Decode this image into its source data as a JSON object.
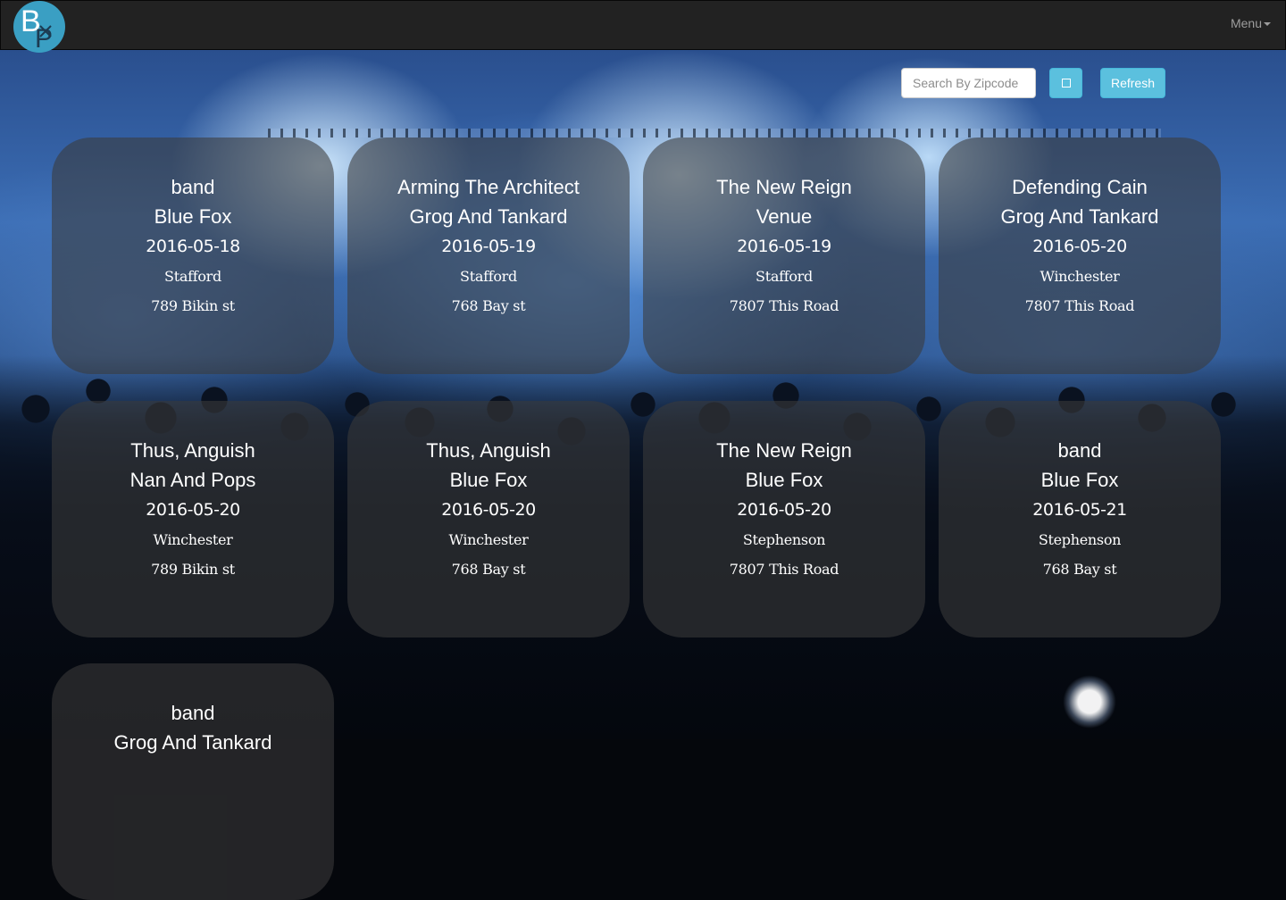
{
  "navbar": {
    "logo_letters": "BP",
    "menu_label": "Menu"
  },
  "toolbar": {
    "search_placeholder": "Search By Zipcode",
    "square_icon": "square-icon",
    "refresh_label": "Refresh"
  },
  "colors": {
    "navbar": "#222222",
    "accent": "#5bc0de",
    "logo": "#3a9fc3",
    "card": "rgba(58,58,58,0.58)"
  },
  "events": [
    {
      "band": "band",
      "venue": "Blue Fox",
      "date": "2016-05-18",
      "city": "Stafford",
      "address": "789 Bikin st"
    },
    {
      "band": "Arming The Architect",
      "venue": "Grog And Tankard",
      "date": "2016-05-19",
      "city": "Stafford",
      "address": "768 Bay st"
    },
    {
      "band": "The New Reign",
      "venue": "Venue",
      "date": "2016-05-19",
      "city": "Stafford",
      "address": "7807 This Road"
    },
    {
      "band": "Defending Cain",
      "venue": "Grog And Tankard",
      "date": "2016-05-20",
      "city": "Winchester",
      "address": "7807 This Road"
    },
    {
      "band": "Thus, Anguish",
      "venue": "Nan And Pops",
      "date": "2016-05-20",
      "city": "Winchester",
      "address": "789 Bikin st"
    },
    {
      "band": "Thus, Anguish",
      "venue": "Blue Fox",
      "date": "2016-05-20",
      "city": "Winchester",
      "address": "768 Bay st"
    },
    {
      "band": "The New Reign",
      "venue": "Blue Fox",
      "date": "2016-05-20",
      "city": "Stephenson",
      "address": "7807 This Road"
    },
    {
      "band": "band",
      "venue": "Blue Fox",
      "date": "2016-05-21",
      "city": "Stephenson",
      "address": "768 Bay st"
    },
    {
      "band": "band",
      "venue": "Grog And Tankard",
      "date": "",
      "city": "",
      "address": ""
    }
  ]
}
